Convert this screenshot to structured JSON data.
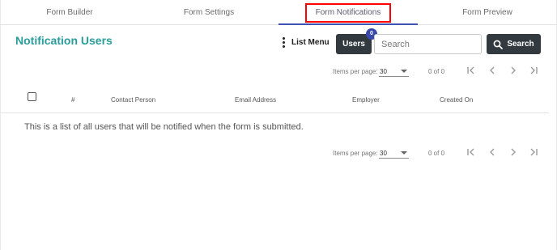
{
  "tabs": [
    {
      "label": "Form Builder"
    },
    {
      "label": "Form Settings"
    },
    {
      "label": "Form Notifications"
    },
    {
      "label": "Form Preview"
    }
  ],
  "header": {
    "title": "Notification Users",
    "list_menu_label": "List Menu",
    "users_button_label": "Users",
    "users_badge_count": "0",
    "search_placeholder": "Search",
    "search_button_label": "Search"
  },
  "paginator_top": {
    "items_per_page_label": "Items per page:",
    "items_per_page_value": "30",
    "range_label": "0 of 0"
  },
  "table": {
    "columns": [
      "#",
      "Contact Person",
      "Email Address",
      "Employer",
      "Created On"
    ],
    "empty_message": "This is a list of all users that will be notified when the form is submitted."
  },
  "paginator_bottom": {
    "items_per_page_label": "Items per page:",
    "items_per_page_value": "30",
    "range_label": "0 of 0"
  },
  "colors": {
    "accent_teal": "#2a9d9b",
    "active_tab_underline": "#3f51b5",
    "highlight_box": "#ff0000",
    "dark_button": "#333a3f",
    "badge": "#3949ab"
  },
  "icons": {
    "list_menu": "kebab-vertical-icon",
    "search": "magnifier-icon",
    "first_page": "first-page-icon",
    "previous_page": "chevron-left-icon",
    "next_page": "chevron-right-icon",
    "last_page": "last-page-icon",
    "items_per_page_dropdown": "caret-down-icon"
  }
}
